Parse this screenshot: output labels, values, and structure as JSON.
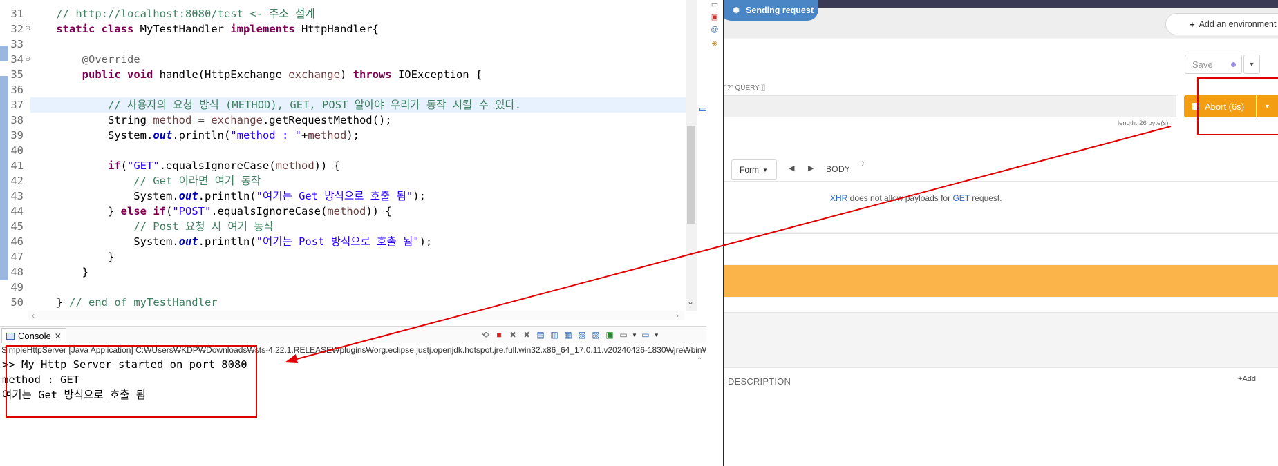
{
  "editor": {
    "lines": [
      {
        "num": "31",
        "tokens": [
          [
            "    ",
            "plain"
          ],
          [
            "// http://localhost:8080/test <- 주소 설계",
            "comment"
          ]
        ]
      },
      {
        "num": "32",
        "fold": "⊖",
        "tokens": [
          [
            "    ",
            "plain"
          ],
          [
            "static",
            "kw"
          ],
          [
            " ",
            "plain"
          ],
          [
            "class",
            "kw"
          ],
          [
            " MyTestHandler ",
            "plain"
          ],
          [
            "implements",
            "kw"
          ],
          [
            " HttpHandler{",
            "plain"
          ]
        ]
      },
      {
        "num": "33",
        "tokens": []
      },
      {
        "num": "34",
        "fold": "⊖",
        "tokens": [
          [
            "        ",
            "plain"
          ],
          [
            "@Override",
            "ann"
          ]
        ]
      },
      {
        "num": "35",
        "tokens": [
          [
            "        ",
            "plain"
          ],
          [
            "public",
            "kw"
          ],
          [
            " ",
            "plain"
          ],
          [
            "void",
            "kw"
          ],
          [
            " handle(HttpExchange ",
            "plain"
          ],
          [
            "exchange",
            "var"
          ],
          [
            ") ",
            "plain"
          ],
          [
            "throws",
            "kw"
          ],
          [
            " IOException {",
            "plain"
          ]
        ]
      },
      {
        "num": "36",
        "tokens": []
      },
      {
        "num": "37",
        "current": true,
        "tokens": [
          [
            "            ",
            "plain"
          ],
          [
            "// 사용자의 요청 방식 (METHOD), GET, POST 알아야 우리가 동작 시킬 수 있다.",
            "comment"
          ]
        ]
      },
      {
        "num": "38",
        "tokens": [
          [
            "            String ",
            "plain"
          ],
          [
            "method",
            "var"
          ],
          [
            " = ",
            "plain"
          ],
          [
            "exchange",
            "var"
          ],
          [
            ".getRequestMethod();",
            "plain"
          ]
        ]
      },
      {
        "num": "39",
        "tokens": [
          [
            "            System.",
            "plain"
          ],
          [
            "out",
            "static"
          ],
          [
            ".println(",
            "plain"
          ],
          [
            "\"method : \"",
            "str"
          ],
          [
            "+",
            "plain"
          ],
          [
            "method",
            "var"
          ],
          [
            ");",
            "plain"
          ]
        ]
      },
      {
        "num": "40",
        "tokens": []
      },
      {
        "num": "41",
        "tokens": [
          [
            "            ",
            "plain"
          ],
          [
            "if",
            "kw"
          ],
          [
            "(",
            "plain"
          ],
          [
            "\"GET\"",
            "str"
          ],
          [
            ".equalsIgnoreCase(",
            "plain"
          ],
          [
            "method",
            "var"
          ],
          [
            ")) {",
            "plain"
          ]
        ]
      },
      {
        "num": "42",
        "tokens": [
          [
            "                ",
            "plain"
          ],
          [
            "// Get 이라면 여기 동작",
            "comment"
          ]
        ]
      },
      {
        "num": "43",
        "tokens": [
          [
            "                System.",
            "plain"
          ],
          [
            "out",
            "static"
          ],
          [
            ".println(",
            "plain"
          ],
          [
            "\"여기는 Get 방식으로 호출 됨\"",
            "str"
          ],
          [
            ");",
            "plain"
          ]
        ]
      },
      {
        "num": "44",
        "tokens": [
          [
            "            } ",
            "plain"
          ],
          [
            "else",
            "kw"
          ],
          [
            " ",
            "plain"
          ],
          [
            "if",
            "kw"
          ],
          [
            "(",
            "plain"
          ],
          [
            "\"POST\"",
            "str"
          ],
          [
            ".equalsIgnoreCase(",
            "plain"
          ],
          [
            "method",
            "var"
          ],
          [
            ")) {",
            "plain"
          ]
        ]
      },
      {
        "num": "45",
        "tokens": [
          [
            "                ",
            "plain"
          ],
          [
            "// Post 요청 시 여기 동작",
            "comment"
          ]
        ]
      },
      {
        "num": "46",
        "tokens": [
          [
            "                System.",
            "plain"
          ],
          [
            "out",
            "static"
          ],
          [
            ".println(",
            "plain"
          ],
          [
            "\"여기는 Post 방식으로 호출 됨\"",
            "str"
          ],
          [
            ");",
            "plain"
          ]
        ]
      },
      {
        "num": "47",
        "tokens": [
          [
            "            }",
            "plain"
          ]
        ]
      },
      {
        "num": "48",
        "tokens": [
          [
            "        }",
            "plain"
          ]
        ]
      },
      {
        "num": "49",
        "tokens": []
      },
      {
        "num": "50",
        "tokens": [
          [
            "    } ",
            "plain"
          ],
          [
            "// end of myTestHandler",
            "comment"
          ]
        ]
      }
    ]
  },
  "console": {
    "tab_label": "Console",
    "path": "SimpleHttpServer [Java Application] C:₩Users₩KDP₩Downloads₩sts-4.22.1.RELEASE₩plugins₩org.eclipse.justj.openjdk.hotspot.jre.full.win32.x86_64_17.0.11.v20240426-1830₩jre₩bin₩javaw.exe",
    "output": [
      ">> My Http Server started on port 8080",
      "method : GET",
      "여기는 Get 방식으로 호출 됨"
    ]
  },
  "client": {
    "sending_label": "Sending request",
    "add_environment_label": "Add an environment",
    "save_label": "Save",
    "query_hint": "\"?\" QUERY ]]",
    "abort_label": "Abort (6s)",
    "length_label": "length: 26 byte(s)",
    "form_label": "Form",
    "body_label": "BODY",
    "body_help": "?",
    "xhr_link": "XHR",
    "xhr_text_1": " does not allow payloads for ",
    "xhr_method": "GET",
    "xhr_text_2": " request.",
    "description_label": "DESCRIPTION",
    "description_add": "Add"
  },
  "colors": {
    "abort": "#f29d12",
    "orange_band": "#fbb44a",
    "sending_pill": "#4a86c5",
    "annotation": "#e00000"
  }
}
